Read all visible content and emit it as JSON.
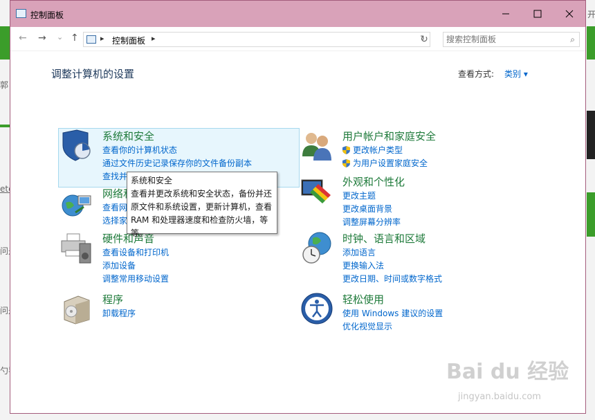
{
  "window": {
    "title": "控制面板"
  },
  "nav": {
    "back": "←",
    "forward": "→",
    "dropdown": "⌄",
    "up": "↑"
  },
  "address": {
    "separator": "▸",
    "path": "控制面板",
    "path_separator": "▸"
  },
  "search": {
    "placeholder": "搜索控制面板"
  },
  "page": {
    "title": "调整计算机的设置"
  },
  "view": {
    "label": "查看方式:",
    "value": "类别 ▾"
  },
  "categories": [
    {
      "title": "系统和安全",
      "links": [
        "查看你的计算机状态",
        "通过文件历史记录保存你的文件备份副本",
        "查找并解决问题"
      ]
    },
    {
      "title": "网络和 Internet",
      "links": [
        "查看网络状态和任务",
        "选择家庭组和共享选项"
      ]
    },
    {
      "title": "硬件和声音",
      "links": [
        "查看设备和打印机",
        "添加设备",
        "调整常用移动设置"
      ]
    },
    {
      "title": "程序",
      "links": [
        "卸载程序"
      ]
    },
    {
      "title": "用户帐户和家庭安全",
      "links": [
        "更改帐户类型",
        "为用户设置家庭安全"
      ]
    },
    {
      "title": "外观和个性化",
      "links": [
        "更改主题",
        "更改桌面背景",
        "调整屏幕分辨率"
      ]
    },
    {
      "title": "时钟、语言和区域",
      "links": [
        "添加语言",
        "更换输入法",
        "更改日期、时间或数字格式"
      ]
    },
    {
      "title": "轻松使用",
      "links": [
        "使用 Windows 建议的设置",
        "优化视觉显示"
      ]
    }
  ],
  "tooltip": {
    "title": "系统和安全",
    "body": "查看并更改系统和安全状态，备份并还原文件和系统设置，更新计算机，查看 RAM 和处理器速度和检查防火墙，等等。"
  },
  "watermark": {
    "text": "Bai du 经验",
    "sub": "jingyan.baidu.com"
  },
  "background": {
    "t1": "郭",
    "t2": "ete",
    "t3": "问是",
    "t4": "问是",
    "t5": "勺导",
    "t6": "开"
  }
}
